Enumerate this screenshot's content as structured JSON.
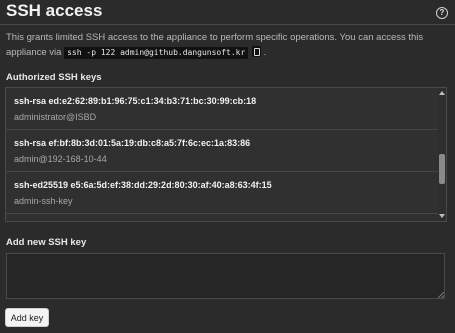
{
  "header": {
    "title": "SSH access",
    "help_icon": "?"
  },
  "description": {
    "text_before": "This grants limited SSH access to the appliance to perform specific operations. You can access this appliance via ",
    "command": "ssh -p 122 admin@github.dangunsoft.kr",
    "text_after": "."
  },
  "authorized_keys": {
    "label": "Authorized SSH keys",
    "keys": [
      {
        "fingerprint": "ssh-rsa ed:e2:62:89:b1:96:75:c1:34:b3:71:bc:30:99:cb:18",
        "name": "administrator@ISBD"
      },
      {
        "fingerprint": "ssh-rsa ef:bf:8b:3d:01:5a:19:db:c8:a5:7f:6c:ec:1a:83:86",
        "name": "admin@192-168-10-44"
      },
      {
        "fingerprint": "ssh-ed25519 e5:6a:5d:ef:38:dd:29:2d:80:30:af:40:a8:63:4f:15",
        "name": "admin-ssh-key"
      }
    ]
  },
  "new_key": {
    "label": "Add new SSH key",
    "value": "",
    "placeholder": ""
  },
  "actions": {
    "add_key_label": "Add key"
  }
}
